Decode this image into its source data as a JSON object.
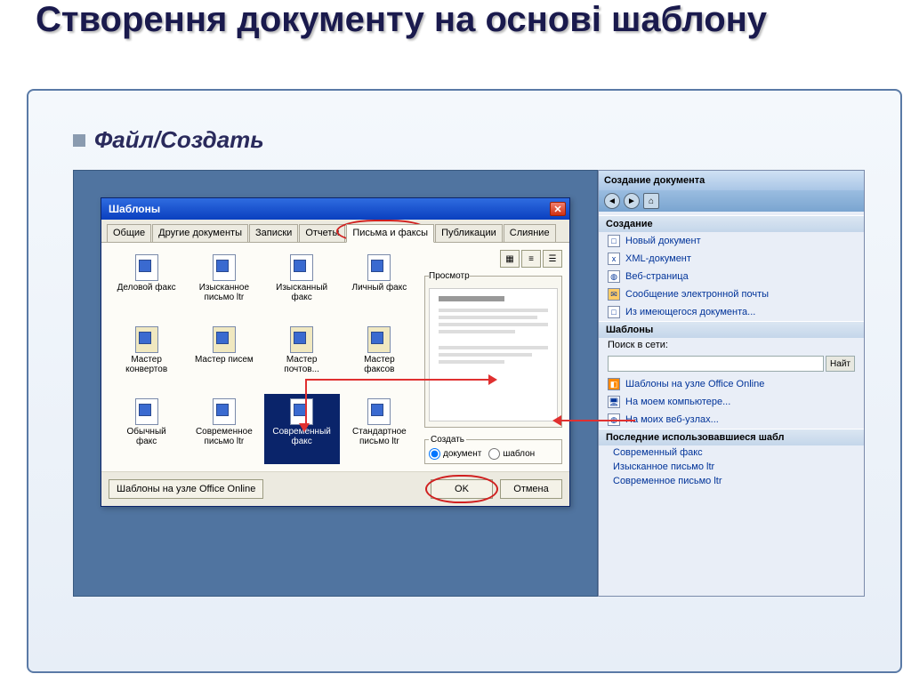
{
  "slide": {
    "title": "Створення документу на основі шаблону",
    "bullet": "Файл/Создать"
  },
  "dialog": {
    "title": "Шаблоны",
    "tabs": [
      "Общие",
      "Другие документы",
      "Записки",
      "Отчеты",
      "Письма и факсы",
      "Публикации",
      "Слияние"
    ],
    "active_tab": "Письма и факсы",
    "templates": [
      {
        "label": "Деловой факс",
        "wizard": false
      },
      {
        "label": "Изысканное письмо ltr",
        "wizard": false
      },
      {
        "label": "Изысканный факс",
        "wizard": false
      },
      {
        "label": "Личный факс",
        "wizard": false
      },
      {
        "label": "Мастер конвертов",
        "wizard": true
      },
      {
        "label": "Мастер писем",
        "wizard": true
      },
      {
        "label": "Мастер почтов...",
        "wizard": true
      },
      {
        "label": "Мастер факсов",
        "wizard": true
      },
      {
        "label": "Обычный факс",
        "wizard": false
      },
      {
        "label": "Современное письмо ltr",
        "wizard": false
      },
      {
        "label": "Современный факс",
        "wizard": false
      },
      {
        "label": "Стандартное письмо ltr",
        "wizard": false
      }
    ],
    "selected_template": "Современный факс",
    "preview_label": "Просмотр",
    "create_label": "Создать",
    "radio_doc": "документ",
    "radio_tpl": "шаблон",
    "footer_primary": "Шаблоны на узле Office Online",
    "ok": "OK",
    "cancel": "Отмена"
  },
  "taskpane": {
    "title": "Создание документа",
    "sections": {
      "create": "Создание",
      "templates": "Шаблоны",
      "recent": "Последние использовавшиеся шабл"
    },
    "create_items": [
      "Новый документ",
      "XML-документ",
      "Веб-страница",
      "Сообщение электронной почты",
      "Из имеющегося документа..."
    ],
    "search_label": "Поиск в сети:",
    "search_btn": "Найт",
    "template_items": [
      "Шаблоны на узле Office Online",
      "На моем компьютере...",
      "На моих веб-узлах..."
    ],
    "recent_items": [
      "Современный факс",
      "Изысканное письмо ltr",
      "Современное письмо ltr"
    ]
  }
}
